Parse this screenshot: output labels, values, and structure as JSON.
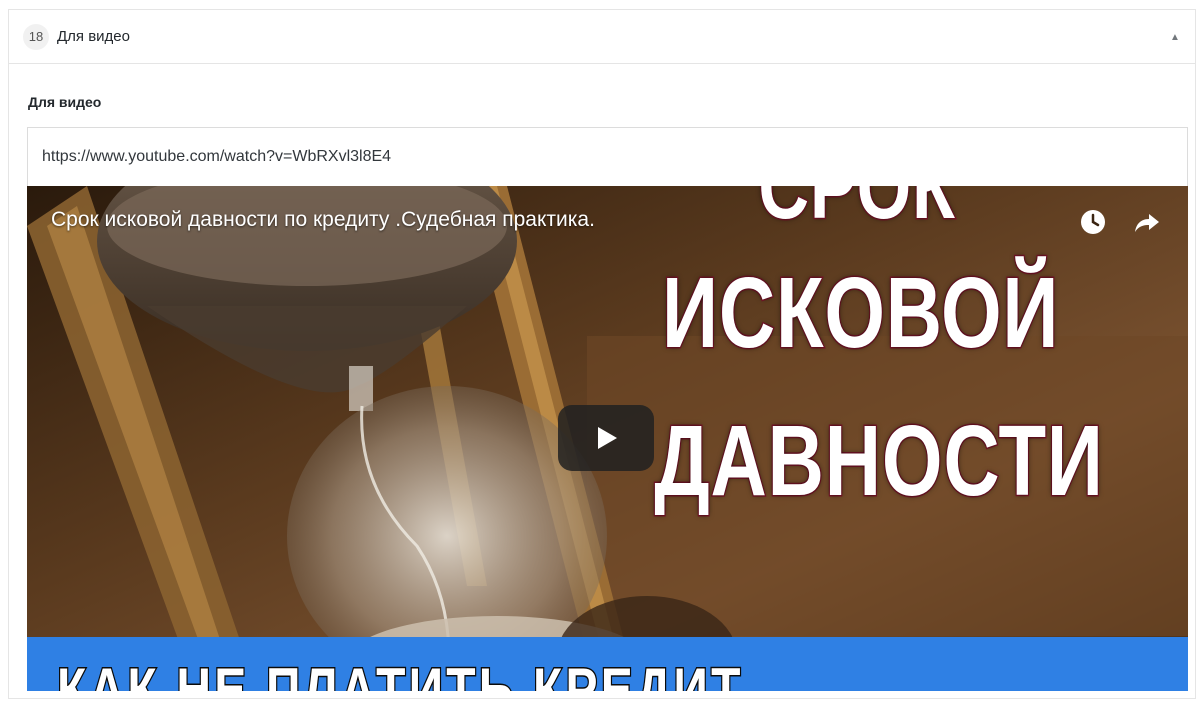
{
  "panel": {
    "index": "18",
    "title": "Для видео",
    "collapse_icon": "triangle-up-icon"
  },
  "field": {
    "label": "Для видео",
    "url": "https://www.youtube.com/watch?v=WbRXvl3l8E4"
  },
  "video": {
    "title": "Срок исковой давности по кредиту .Судебная практика.",
    "watch_later_icon": "clock-icon",
    "share_icon": "share-arrow-icon",
    "play_icon": "play-icon",
    "thumbnail": {
      "line1": "СРОК",
      "line2": "ИСКОВОЙ",
      "line3": "ДАВНОСТИ",
      "banner": "КАК НЕ ПЛАТИТЬ КРЕДИТ"
    },
    "colors": {
      "banner": "#2f80e4",
      "outline": "#7a1528"
    }
  }
}
